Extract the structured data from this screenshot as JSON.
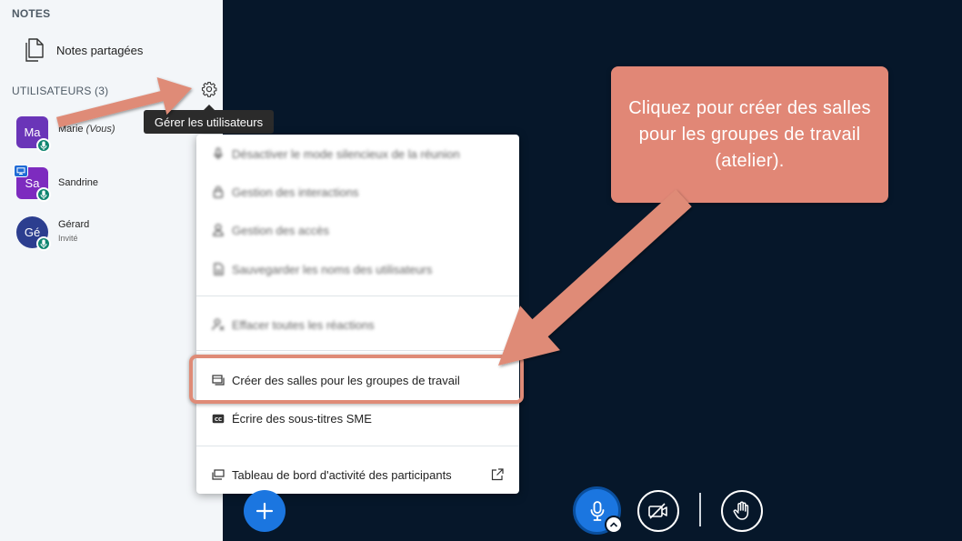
{
  "sidebar": {
    "notes_title": "NOTES",
    "shared_notes_label": "Notes partagées",
    "users_title": "UTILISATEURS (3)",
    "users": [
      {
        "initials": "Ma",
        "name": "Marie",
        "name_suffix": "(Vous)",
        "role": "",
        "color": "#6a35b8"
      },
      {
        "initials": "Sa",
        "name": "Sandrine",
        "name_suffix": "",
        "role": "",
        "color": "#7d2bbf"
      },
      {
        "initials": "Gé",
        "name": "Gérard",
        "name_suffix": "",
        "role": "Invité",
        "color": "#2c3e8f"
      }
    ]
  },
  "tooltip": "Gérer les utilisateurs",
  "menu": {
    "items": [
      {
        "label": "Désactiver le mode silencieux de la réunion",
        "icon": "mic-icon"
      },
      {
        "label": "Gestion des interactions",
        "icon": "lock-icon"
      },
      {
        "label": "Gestion des accès",
        "icon": "user-icon"
      },
      {
        "label": "Sauvegarder les noms des utilisateurs",
        "icon": "file-icon"
      },
      {
        "label": "Effacer toutes les réactions",
        "icon": "clear-status-icon"
      },
      {
        "label": "Créer des salles pour les groupes de travail",
        "icon": "rooms-icon"
      },
      {
        "label": "Écrire des sous-titres SME",
        "icon": "closed-caption-icon"
      },
      {
        "label": "Tableau de bord d'activité des participants",
        "icon": "dashboard-icon"
      }
    ]
  },
  "callout": "Cliquez pour créer des salles pour les groupes de travail (atelier).",
  "colors": {
    "background": "#06172a",
    "sidebar": "#f3f6f9",
    "accent": "#1b76e0",
    "callout": "#e18776",
    "mic_badge": "#0f8570"
  }
}
